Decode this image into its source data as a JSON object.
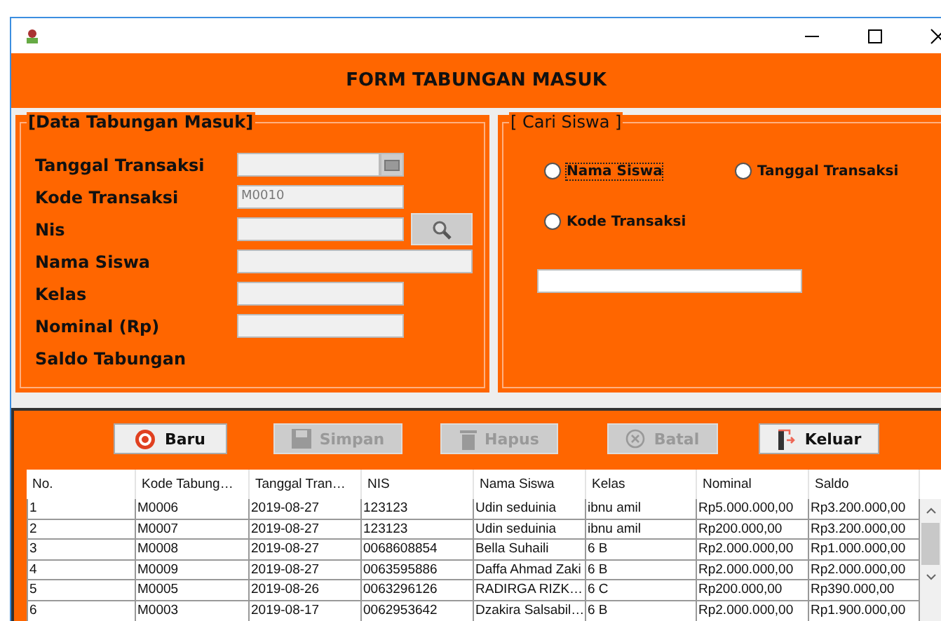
{
  "header": {
    "title": "FORM TABUNGAN MASUK"
  },
  "data_panel": {
    "legend": "[Data Tabungan Masuk]",
    "fields": [
      {
        "label": "Tanggal Transaksi",
        "kind": "date"
      },
      {
        "label": "Kode Transaksi",
        "kind": "text",
        "value": "M0010",
        "disabled": true
      },
      {
        "label": "Nis",
        "kind": "search"
      },
      {
        "label": "Nama Siswa",
        "kind": "wide"
      },
      {
        "label": "Kelas",
        "kind": "text"
      },
      {
        "label": "Nominal (Rp)",
        "kind": "text"
      },
      {
        "label": "Saldo Tabungan",
        "kind": "label"
      }
    ]
  },
  "search_panel": {
    "legend": "[ Cari Siswa ]",
    "options": [
      {
        "label": "Nama Siswa",
        "selected": false,
        "focused": true
      },
      {
        "label": "Tanggal Transaksi",
        "selected": false,
        "focused": false
      },
      {
        "label": "Kode Transaksi",
        "selected": false,
        "focused": false
      }
    ]
  },
  "buttons": [
    {
      "label": "Baru",
      "kind": "new",
      "disabled": false
    },
    {
      "label": "Simpan",
      "kind": "save",
      "disabled": true
    },
    {
      "label": "Hapus",
      "kind": "delete",
      "disabled": true
    },
    {
      "label": "Batal",
      "kind": "cancel",
      "disabled": true
    },
    {
      "label": "Keluar",
      "kind": "exit",
      "disabled": false
    }
  ],
  "table": {
    "columns": [
      "No.",
      "Kode Tabung…",
      "Tanggal Tran…",
      "NIS",
      "Nama Siswa",
      "Kelas",
      "Nominal",
      "Saldo"
    ],
    "rows": [
      [
        "1",
        "M0006",
        "2019-08-27",
        "123123",
        "Udin seduinia",
        "ibnu amil",
        "Rp5.000.000,00",
        "Rp3.200.000,00"
      ],
      [
        "2",
        "M0007",
        "2019-08-27",
        "123123",
        "Udin seduinia",
        "ibnu amil",
        "Rp200.000,00",
        "Rp3.200.000,00"
      ],
      [
        "3",
        "M0008",
        "2019-08-27",
        "0068608854",
        "Bella Suhaili",
        "6 B",
        "Rp2.000.000,00",
        "Rp1.000.000,00"
      ],
      [
        "4",
        "M0009",
        "2019-08-27",
        "0063595886",
        "Daffa Ahmad Zaki",
        "6 B",
        "Rp2.000.000,00",
        "Rp2.000.000,00"
      ],
      [
        "5",
        "M0005",
        "2019-08-26",
        "0063296126",
        "RADIRGA RIZK…",
        "6 C",
        "Rp200.000,00",
        "Rp390.000,00"
      ],
      [
        "6",
        "M0003",
        "2019-08-17",
        "0062953642",
        "Dzakira Salsabil…",
        "6 B",
        "Rp2.000.000,00",
        "Rp1.900.000,00"
      ]
    ]
  }
}
